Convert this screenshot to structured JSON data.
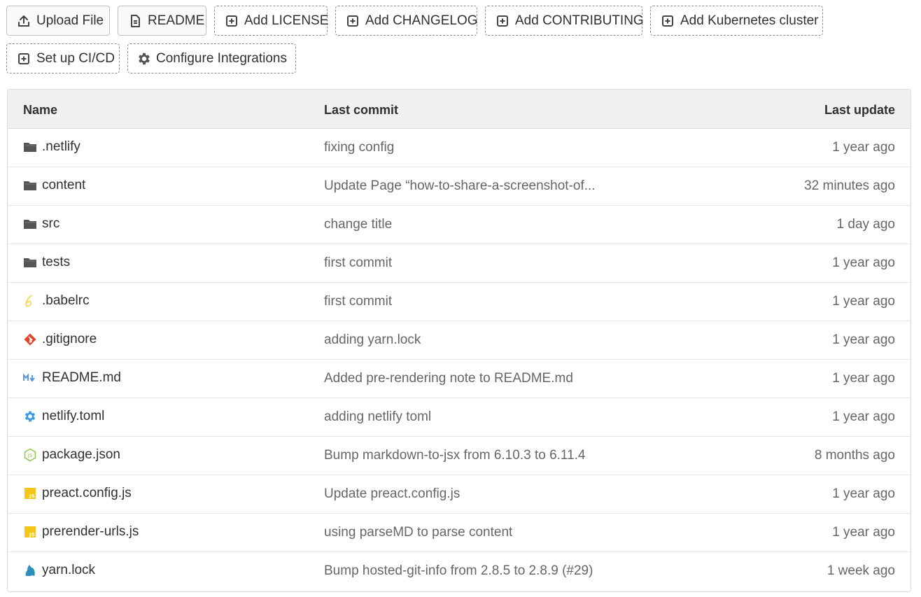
{
  "toolbar": {
    "buttons": [
      {
        "label": "Upload File",
        "icon": "upload-icon",
        "style": "solid"
      },
      {
        "label": "README",
        "icon": "document-icon",
        "style": "solid"
      },
      {
        "label": "Add LICENSE",
        "icon": "plus-square-icon",
        "style": "dashed"
      },
      {
        "label": "Add CHANGELOG",
        "icon": "plus-square-icon",
        "style": "dashed"
      },
      {
        "label": "Add CONTRIBUTING",
        "icon": "plus-square-icon",
        "style": "dashed"
      },
      {
        "label": "Add Kubernetes cluster",
        "icon": "plus-square-icon",
        "style": "dashed"
      },
      {
        "label": "Set up CI/CD",
        "icon": "plus-square-icon",
        "style": "dashed"
      },
      {
        "label": "Configure Integrations",
        "icon": "gear-icon",
        "style": "dashed"
      }
    ]
  },
  "table": {
    "headers": {
      "name": "Name",
      "last_commit": "Last commit",
      "last_update": "Last update"
    },
    "rows": [
      {
        "name": ".netlify",
        "icon": "folder-icon",
        "commit": "fixing config",
        "updated": "1 year ago"
      },
      {
        "name": "content",
        "icon": "folder-icon",
        "commit": "Update Page “how-to-share-a-screenshot-of...",
        "updated": "32 minutes ago"
      },
      {
        "name": "src",
        "icon": "folder-icon",
        "commit": "change title",
        "updated": "1 day ago"
      },
      {
        "name": "tests",
        "icon": "folder-icon",
        "commit": "first commit",
        "updated": "1 year ago"
      },
      {
        "name": ".babelrc",
        "icon": "babel-icon",
        "commit": "first commit",
        "updated": "1 year ago"
      },
      {
        "name": ".gitignore",
        "icon": "git-icon",
        "commit": "adding yarn.lock",
        "updated": "1 year ago"
      },
      {
        "name": "README.md",
        "icon": "markdown-icon",
        "commit": "Added pre-rendering note to README.md",
        "updated": "1 year ago"
      },
      {
        "name": "netlify.toml",
        "icon": "settings-file-icon",
        "commit": "adding netlify toml",
        "updated": "1 year ago"
      },
      {
        "name": "package.json",
        "icon": "nodejs-icon",
        "commit": "Bump markdown-to-jsx from 6.10.3 to 6.11.4",
        "updated": "8 months ago"
      },
      {
        "name": "preact.config.js",
        "icon": "javascript-icon",
        "commit": "Update preact.config.js",
        "updated": "1 year ago"
      },
      {
        "name": "prerender-urls.js",
        "icon": "javascript-icon",
        "commit": "using parseMD to parse content",
        "updated": "1 year ago"
      },
      {
        "name": "yarn.lock",
        "icon": "yarn-icon",
        "commit": "Bump hosted-git-info from 2.8.5 to 2.8.9 (#29)",
        "updated": "1 week ago"
      }
    ]
  },
  "colors": {
    "folder": "#555555",
    "babel": "#f5da55",
    "git": "#e24329",
    "markdown": "#4a90e2",
    "settings": "#3b9ae8",
    "node": "#8cc84b",
    "javascript": "#f5c518",
    "yarn": "#2c8ebb"
  }
}
